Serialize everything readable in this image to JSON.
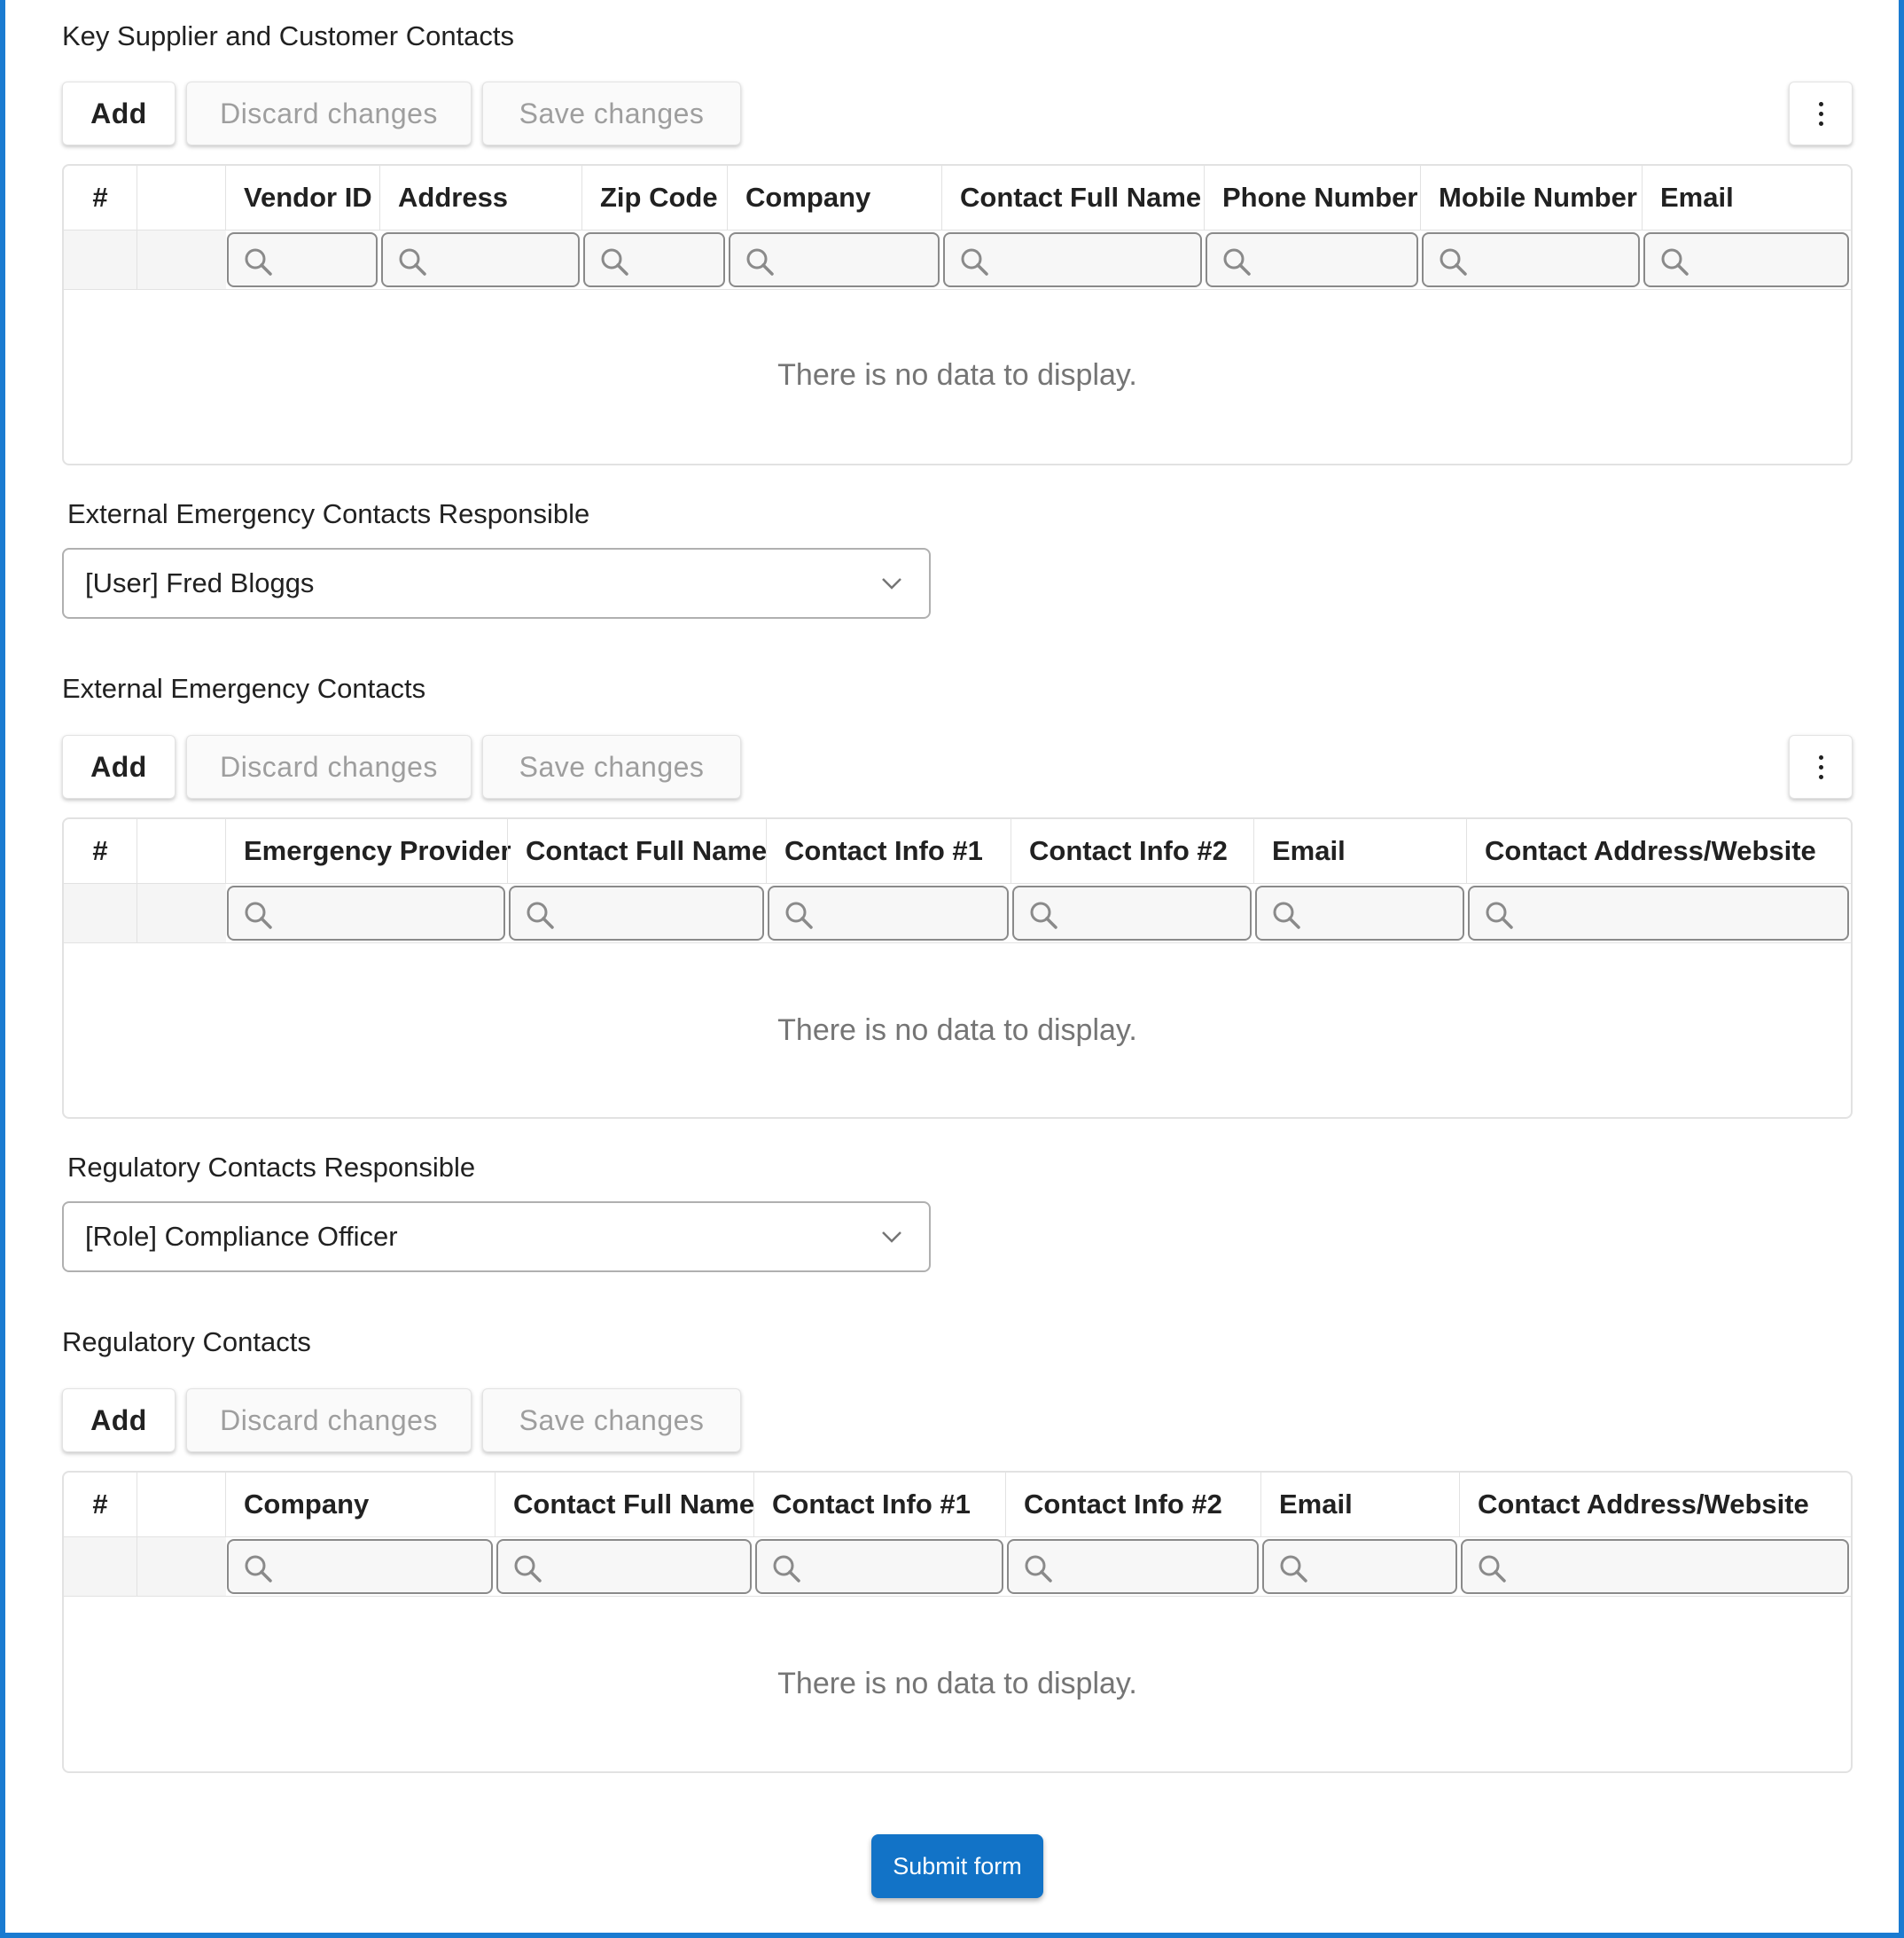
{
  "section1": {
    "title": "Key Supplier and Customer Contacts",
    "toolbar": {
      "add": "Add",
      "discard": "Discard changes",
      "save": "Save changes"
    },
    "columns": [
      "#",
      "",
      "Vendor ID",
      "Address",
      "Zip Code",
      "Company",
      "Contact Full Name",
      "Phone Number",
      "Mobile Number",
      "Email"
    ],
    "empty_text": "There is no data to display."
  },
  "field1": {
    "label": "External Emergency Contacts Responsible",
    "value": "[User] Fred Bloggs"
  },
  "section2": {
    "title": "External Emergency Contacts",
    "toolbar": {
      "add": "Add",
      "discard": "Discard changes",
      "save": "Save changes"
    },
    "columns": [
      "#",
      "",
      "Emergency Provider",
      "Contact Full Name",
      "Contact Info #1",
      "Contact Info #2",
      "Email",
      "Contact Address/Website"
    ],
    "empty_text": "There is no data to display."
  },
  "field2": {
    "label": "Regulatory Contacts Responsible",
    "value": "[Role] Compliance Officer"
  },
  "section3": {
    "title": "Regulatory Contacts",
    "toolbar": {
      "add": "Add",
      "discard": "Discard changes",
      "save": "Save changes"
    },
    "columns": [
      "#",
      "",
      "Company",
      "Contact Full Name",
      "Contact Info #1",
      "Contact Info #2",
      "Email",
      "Contact Address/Website"
    ],
    "empty_text": "There is no data to display."
  },
  "submit_label": "Submit form",
  "colors": {
    "accent": "#1273c7",
    "frame": "#1a7bd1"
  },
  "icons": {
    "search": "search-icon",
    "more": "more-vertical-icon",
    "dropdown": "chevron-down-icon"
  }
}
